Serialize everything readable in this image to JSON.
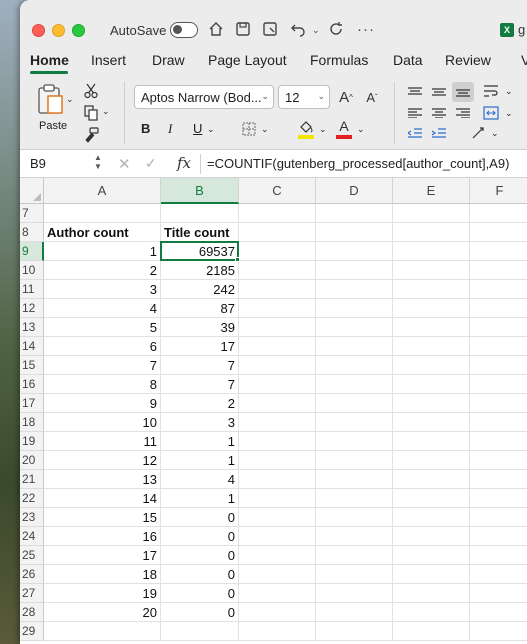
{
  "titlebar": {
    "autosave_label": "AutoSave",
    "doc_title": "g",
    "icons": [
      "home-icon",
      "save-icon",
      "save-as-icon",
      "undo-icon",
      "redo-icon",
      "more-icon"
    ]
  },
  "tabs": [
    "Home",
    "Insert",
    "Draw",
    "Page Layout",
    "Formulas",
    "Data",
    "Review",
    "Vi"
  ],
  "active_tab": "Home",
  "ribbon": {
    "paste_label": "Paste",
    "font_name": "Aptos Narrow (Bod...",
    "font_size": "12",
    "grow_font": "A",
    "shrink_font": "A",
    "bold": "B",
    "italic": "I",
    "underline": "U",
    "font_color_letter": "A",
    "accent_color": "#107c41",
    "highlight_color": "#f2e600",
    "font_color": "#e02020"
  },
  "formula_bar": {
    "name_box": "B9",
    "fx": "fx",
    "formula": "=COUNTIF(gutenberg_processed[author_count],A9)"
  },
  "columns": [
    "A",
    "B",
    "C",
    "D",
    "E",
    "F"
  ],
  "selected_column": "B",
  "selected_row": "9",
  "rows": [
    {
      "num": "7",
      "a": "",
      "b": ""
    },
    {
      "num": "8",
      "a": "Author count",
      "b": "Title count",
      "header": true
    },
    {
      "num": "9",
      "a": "1",
      "b": "69537"
    },
    {
      "num": "10",
      "a": "2",
      "b": "2185"
    },
    {
      "num": "11",
      "a": "3",
      "b": "242"
    },
    {
      "num": "12",
      "a": "4",
      "b": "87"
    },
    {
      "num": "13",
      "a": "5",
      "b": "39"
    },
    {
      "num": "14",
      "a": "6",
      "b": "17"
    },
    {
      "num": "15",
      "a": "7",
      "b": "7"
    },
    {
      "num": "16",
      "a": "8",
      "b": "7"
    },
    {
      "num": "17",
      "a": "9",
      "b": "2"
    },
    {
      "num": "18",
      "a": "10",
      "b": "3"
    },
    {
      "num": "19",
      "a": "11",
      "b": "1"
    },
    {
      "num": "20",
      "a": "12",
      "b": "1"
    },
    {
      "num": "21",
      "a": "13",
      "b": "4"
    },
    {
      "num": "22",
      "a": "14",
      "b": "1"
    },
    {
      "num": "23",
      "a": "15",
      "b": "0"
    },
    {
      "num": "24",
      "a": "16",
      "b": "0"
    },
    {
      "num": "25",
      "a": "17",
      "b": "0"
    },
    {
      "num": "26",
      "a": "18",
      "b": "0"
    },
    {
      "num": "27",
      "a": "19",
      "b": "0"
    },
    {
      "num": "28",
      "a": "20",
      "b": "0"
    },
    {
      "num": "29",
      "a": "",
      "b": ""
    }
  ]
}
